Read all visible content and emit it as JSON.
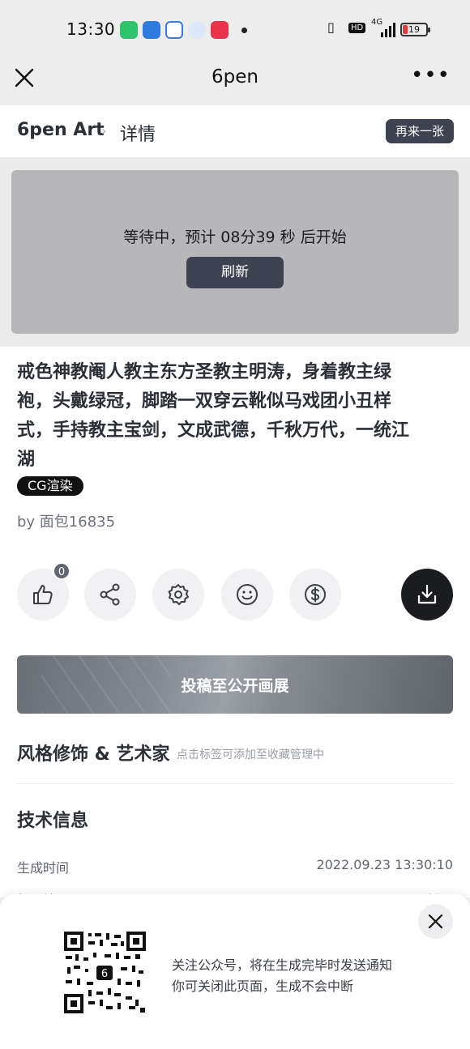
{
  "status_bar": {
    "time": "13:30",
    "network": "HD",
    "signal": "4G",
    "battery": "19"
  },
  "nav": {
    "title": "6pen",
    "more": "•••"
  },
  "breadcrumb": {
    "root": "6pen Art",
    "separator": "›",
    "current": "详情",
    "again_button": "再来一张"
  },
  "image_area": {
    "wait_text": "等待中，预计 08分39 秒 后开始",
    "refresh_button": "刷新"
  },
  "prompt": {
    "line1": "戒色神教阉人教主东方圣教主明涛，身着教主绿",
    "line2": "袍，头戴绿冠，脚踏一双穿云靴似马戏团小丑样",
    "line3": "式，手持教主宝剑，文成武德，千秋万代，一统江",
    "line4": "湖"
  },
  "tag": "CG渲染",
  "author": "by 面包16835",
  "actions": {
    "like_count": "0",
    "icons": [
      "thumbs-up-icon",
      "share-icon",
      "settings-icon",
      "smiley-icon",
      "dollar-icon",
      "download-icon"
    ]
  },
  "submit_button": "投稿至公开画展",
  "style_section": {
    "title": "风格修饰 & 艺术家",
    "hint": "点击标签可添加至收藏管理中"
  },
  "tech_info": {
    "title": "技术信息",
    "rows": [
      {
        "label": "生成时间",
        "value": "2022.09.23 13:30:10"
      },
      {
        "label": "机器编号",
        "value": "暂无"
      }
    ]
  },
  "popup": {
    "line1": "关注公众号，将在生成完毕时发送通知",
    "line2": "你可关闭此页面，生成不会中断"
  },
  "colors": {
    "dark_button": "#3d4350",
    "image_placeholder": "#b7b7b9",
    "battery_low": "#e53a3a"
  }
}
